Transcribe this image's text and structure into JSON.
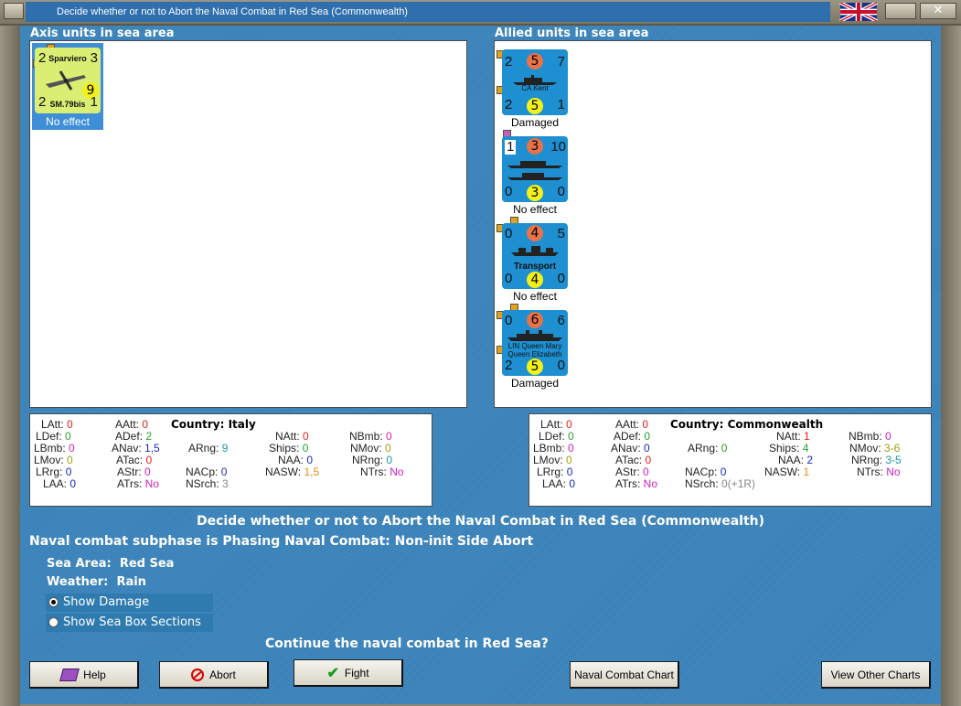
{
  "window": {
    "title": "Decide whether or not to Abort the Naval Combat in Red Sea (Commonwealth)"
  },
  "colors": {
    "axis_counter": "#d9ee72",
    "allied_counter": "#1e8fd0",
    "selected": "#3f8fd8",
    "attack_circle": "#e8724a",
    "defense_circle": "#f4f01a"
  },
  "axis": {
    "heading": "Axis units in sea area",
    "units": [
      {
        "name": "Sparviero",
        "subname": "SM.79bis",
        "tl": "2",
        "tr": "3",
        "mid": "9",
        "bl": "2",
        "br": "1",
        "status": "No effect"
      }
    ]
  },
  "allied": {
    "heading": "Allied units in sea area",
    "units": [
      {
        "name": "CA Kent",
        "tl": "2",
        "tc": "5",
        "tr": "7",
        "bl": "2",
        "bc": "5",
        "br": "1",
        "status": "Damaged"
      },
      {
        "name": "",
        "tl": "1",
        "tc": "3",
        "tr": "10",
        "bl": "0",
        "bc": "3",
        "br": "0",
        "status": "No effect"
      },
      {
        "name": "Transport",
        "tl": "0",
        "tc": "4",
        "tr": "5",
        "bl": "0",
        "bc": "4",
        "br": "0",
        "status": "No effect"
      },
      {
        "name": "LIN Queen Mary Queen Elizabeth",
        "tl": "0",
        "tc": "6",
        "tr": "6",
        "bl": "2",
        "bc": "5",
        "br": "0",
        "status": "Damaged"
      }
    ]
  },
  "axis_stats": {
    "country_label": "Country: Italy",
    "LAtt": "0",
    "LDef": "0",
    "LBmb": "0",
    "LMov": "0",
    "LRrg": "0",
    "LAA": "0",
    "AAtt": "0",
    "ADef": "2",
    "ANav": "1,5",
    "ATac": "0",
    "AStr": "0",
    "ATrs": "No",
    "ARng": "9",
    "NACp": "0",
    "NSrch": "3",
    "NAtt": "0",
    "Ships": "0",
    "NAA": "0",
    "NASW": "1,5",
    "NBmb": "0",
    "NMov": "0",
    "NRng": "0",
    "NTrs": "No"
  },
  "allied_stats": {
    "country_label": "Country: Commonwealth",
    "LAtt": "0",
    "LDef": "0",
    "LBmb": "0",
    "LMov": "0",
    "LRrg": "0",
    "LAA": "0",
    "AAtt": "0",
    "ADef": "0",
    "ANav": "0",
    "ATac": "0",
    "AStr": "0",
    "ATrs": "No",
    "ARng": "0",
    "NACp": "0",
    "NSrch": "0(+1R)",
    "NAtt": "1",
    "Ships": "4",
    "NAA": "2",
    "NASW": "1",
    "NBmb": "0",
    "NMov": "3-6",
    "NRng": "3-5",
    "NTrs": "No"
  },
  "messages": {
    "main": "Decide whether or not to Abort the Naval Combat in Red Sea (Commonwealth)",
    "subphase": "Naval combat subphase is Phasing Naval Combat: Non-init Side Abort",
    "sea_area_label": "Sea Area:",
    "sea_area": "Red Sea",
    "weather_label": "Weather:",
    "weather": "Rain",
    "question": "Continue the naval combat in Red Sea?"
  },
  "options": {
    "show_damage": "Show Damage",
    "show_sea_box": "Show Sea Box Sections",
    "selected": "show_damage"
  },
  "buttons": {
    "help": "Help",
    "abort": "Abort",
    "fight": "Fight",
    "naval_chart": "Naval Combat Chart",
    "other_charts": "View Other Charts"
  }
}
